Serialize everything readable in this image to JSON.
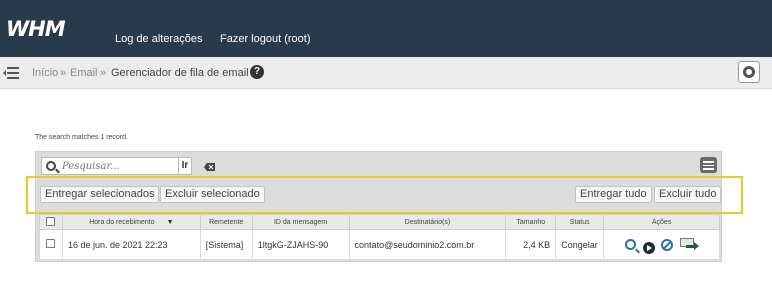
{
  "header": {
    "logo": "WHM",
    "links": [
      "Log de alterações",
      "Fazer logout (root)"
    ]
  },
  "breadcrumb": {
    "items": [
      "Início",
      "Email",
      "Gerenciador de fila de email"
    ],
    "separator": "»",
    "help_icon": "?"
  },
  "queue": {
    "matches_text": "The search matches 1 record.",
    "search": {
      "placeholder": "Pesquisar...",
      "go_label": "Ir"
    },
    "buttons": {
      "deliver_selected": "Entregar selecionados",
      "delete_selected": "Excluir selecionado",
      "deliver_all": "Entregar tudo",
      "delete_all": "Excluir tudo"
    },
    "columns": [
      "",
      "Hora do recebimento",
      "Remetente",
      "ID da mensagem",
      "Destinatário(s)",
      "Tamanho",
      "Status",
      "Ações"
    ],
    "rows": [
      {
        "received": "16 de jun. de 2021 22:23",
        "sender": "[Sistema]",
        "message_id": "1ltgkG-ZJAHS-90",
        "recipient": "contato@seudominio2.com.br",
        "size": "2,4 KB",
        "status": "Congelar"
      }
    ]
  },
  "colors": {
    "header_bg": "#293a4a",
    "highlight": "#f0c826",
    "breadcrumb_bg": "#ececec"
  }
}
